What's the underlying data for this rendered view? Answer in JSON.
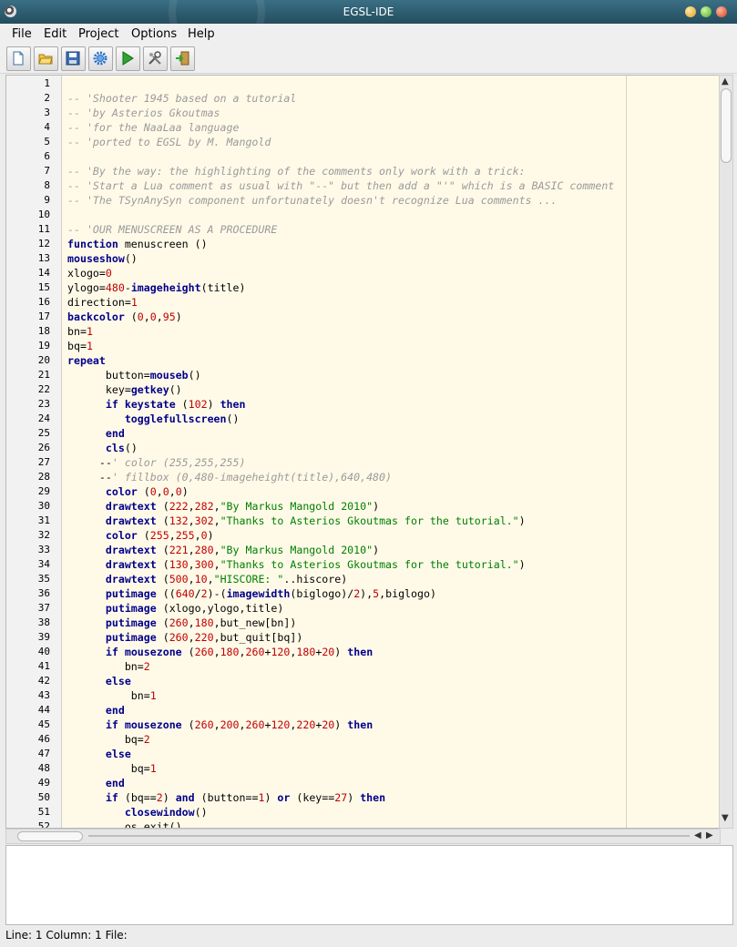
{
  "window": {
    "title": "EGSL-IDE"
  },
  "menu": [
    "File",
    "Edit",
    "Project",
    "Options",
    "Help"
  ],
  "toolbar": [
    {
      "name": "new-file-button",
      "icon": "new-document-icon"
    },
    {
      "name": "open-file-button",
      "icon": "open-folder-icon"
    },
    {
      "name": "save-file-button",
      "icon": "save-disk-icon"
    },
    {
      "name": "settings-button",
      "icon": "gear-icon"
    },
    {
      "name": "run-button",
      "icon": "play-icon"
    },
    {
      "name": "tools-button",
      "icon": "tools-icon"
    },
    {
      "name": "exit-button",
      "icon": "exit-door-icon"
    }
  ],
  "editor": {
    "line_numbers": [
      "1",
      "2",
      "3",
      "4",
      "5",
      "6",
      "7",
      "8",
      "9",
      "10",
      "11",
      "12",
      "13",
      "14",
      "15",
      "16",
      "17",
      "18",
      "19",
      "20",
      "21",
      "22",
      "23",
      "24",
      "25",
      "26",
      "27",
      "28",
      "29",
      "30",
      "31",
      "32",
      "33",
      "34",
      "35",
      "36",
      "37",
      "38",
      "39",
      "40",
      "41",
      "42",
      "43",
      "44",
      "45",
      "46",
      "47",
      "48",
      "49",
      "50",
      "51",
      "52"
    ],
    "lines": [
      [],
      [
        [
          "c",
          "-- 'Shooter 1945 based on a tutorial"
        ]
      ],
      [
        [
          "c",
          "-- 'by Asterios Gkoutmas"
        ]
      ],
      [
        [
          "c",
          "-- 'for the NaaLaa language"
        ]
      ],
      [
        [
          "c",
          "-- 'ported to EGSL by M. Mangold"
        ]
      ],
      [],
      [
        [
          "c",
          "-- 'By the way: the highlighting of the comments only work with a trick:"
        ]
      ],
      [
        [
          "c",
          "-- 'Start a Lua comment as usual with \"--\" but then add a \"'\" which is a BASIC comment"
        ]
      ],
      [
        [
          "c",
          "-- 'The TSynAnySyn component unfortunately doesn't recognize Lua comments ..."
        ]
      ],
      [],
      [
        [
          "c",
          "-- 'OUR MENUSCREEN AS A PROCEDURE"
        ]
      ],
      [
        [
          "k",
          "function"
        ],
        [
          "p",
          " menuscreen ()"
        ]
      ],
      [
        [
          "k",
          "mouseshow"
        ],
        [
          "p",
          "()"
        ]
      ],
      [
        [
          "p",
          "xlogo="
        ],
        [
          "n",
          "0"
        ]
      ],
      [
        [
          "p",
          "ylogo="
        ],
        [
          "n",
          "480"
        ],
        [
          "p",
          "-"
        ],
        [
          "k",
          "imageheight"
        ],
        [
          "p",
          "(title)"
        ]
      ],
      [
        [
          "p",
          "direction="
        ],
        [
          "n",
          "1"
        ]
      ],
      [
        [
          "k",
          "backcolor"
        ],
        [
          "p",
          " ("
        ],
        [
          "n",
          "0"
        ],
        [
          "p",
          ","
        ],
        [
          "n",
          "0"
        ],
        [
          "p",
          ","
        ],
        [
          "n",
          "95"
        ],
        [
          "p",
          ")"
        ]
      ],
      [
        [
          "p",
          "bn="
        ],
        [
          "n",
          "1"
        ]
      ],
      [
        [
          "p",
          "bq="
        ],
        [
          "n",
          "1"
        ]
      ],
      [
        [
          "k",
          "repeat"
        ]
      ],
      [
        [
          "p",
          "      button="
        ],
        [
          "k",
          "mouseb"
        ],
        [
          "p",
          "()"
        ]
      ],
      [
        [
          "p",
          "      key="
        ],
        [
          "k",
          "getkey"
        ],
        [
          "p",
          "()"
        ]
      ],
      [
        [
          "p",
          "      "
        ],
        [
          "k",
          "if"
        ],
        [
          "p",
          " "
        ],
        [
          "k",
          "keystate"
        ],
        [
          "p",
          " ("
        ],
        [
          "n",
          "102"
        ],
        [
          "p",
          ") "
        ],
        [
          "k",
          "then"
        ]
      ],
      [
        [
          "p",
          "         "
        ],
        [
          "k",
          "togglefullscreen"
        ],
        [
          "p",
          "()"
        ]
      ],
      [
        [
          "p",
          "      "
        ],
        [
          "k",
          "end"
        ]
      ],
      [
        [
          "p",
          "      "
        ],
        [
          "k",
          "cls"
        ],
        [
          "p",
          "()"
        ]
      ],
      [
        [
          "p",
          "     --"
        ],
        [
          "c",
          "' color (255,255,255)"
        ]
      ],
      [
        [
          "p",
          "     --"
        ],
        [
          "c",
          "' fillbox (0,480-imageheight(title),640,480)"
        ]
      ],
      [
        [
          "p",
          "      "
        ],
        [
          "k",
          "color"
        ],
        [
          "p",
          " ("
        ],
        [
          "n",
          "0"
        ],
        [
          "p",
          ","
        ],
        [
          "n",
          "0"
        ],
        [
          "p",
          ","
        ],
        [
          "n",
          "0"
        ],
        [
          "p",
          ")"
        ]
      ],
      [
        [
          "p",
          "      "
        ],
        [
          "k",
          "drawtext"
        ],
        [
          "p",
          " ("
        ],
        [
          "n",
          "222"
        ],
        [
          "p",
          ","
        ],
        [
          "n",
          "282"
        ],
        [
          "p",
          ","
        ],
        [
          "s",
          "\"By Markus Mangold 2010\""
        ],
        [
          "p",
          ")"
        ]
      ],
      [
        [
          "p",
          "      "
        ],
        [
          "k",
          "drawtext"
        ],
        [
          "p",
          " ("
        ],
        [
          "n",
          "132"
        ],
        [
          "p",
          ","
        ],
        [
          "n",
          "302"
        ],
        [
          "p",
          ","
        ],
        [
          "s",
          "\"Thanks to Asterios Gkoutmas for the tutorial.\""
        ],
        [
          "p",
          ")"
        ]
      ],
      [
        [
          "p",
          "      "
        ],
        [
          "k",
          "color"
        ],
        [
          "p",
          " ("
        ],
        [
          "n",
          "255"
        ],
        [
          "p",
          ","
        ],
        [
          "n",
          "255"
        ],
        [
          "p",
          ","
        ],
        [
          "n",
          "0"
        ],
        [
          "p",
          ")"
        ]
      ],
      [
        [
          "p",
          "      "
        ],
        [
          "k",
          "drawtext"
        ],
        [
          "p",
          " ("
        ],
        [
          "n",
          "221"
        ],
        [
          "p",
          ","
        ],
        [
          "n",
          "280"
        ],
        [
          "p",
          ","
        ],
        [
          "s",
          "\"By Markus Mangold 2010\""
        ],
        [
          "p",
          ")"
        ]
      ],
      [
        [
          "p",
          "      "
        ],
        [
          "k",
          "drawtext"
        ],
        [
          "p",
          " ("
        ],
        [
          "n",
          "130"
        ],
        [
          "p",
          ","
        ],
        [
          "n",
          "300"
        ],
        [
          "p",
          ","
        ],
        [
          "s",
          "\"Thanks to Asterios Gkoutmas for the tutorial.\""
        ],
        [
          "p",
          ")"
        ]
      ],
      [
        [
          "p",
          "      "
        ],
        [
          "k",
          "drawtext"
        ],
        [
          "p",
          " ("
        ],
        [
          "n",
          "500"
        ],
        [
          "p",
          ","
        ],
        [
          "n",
          "10"
        ],
        [
          "p",
          ","
        ],
        [
          "s",
          "\"HISCORE: \""
        ],
        [
          "p",
          "..hiscore)"
        ]
      ],
      [
        [
          "p",
          "      "
        ],
        [
          "k",
          "putimage"
        ],
        [
          "p",
          " (("
        ],
        [
          "n",
          "640"
        ],
        [
          "p",
          "/"
        ],
        [
          "n",
          "2"
        ],
        [
          "p",
          ")-("
        ],
        [
          "k",
          "imagewidth"
        ],
        [
          "p",
          "(biglogo)/"
        ],
        [
          "n",
          "2"
        ],
        [
          "p",
          "),"
        ],
        [
          "n",
          "5"
        ],
        [
          "p",
          ",biglogo)"
        ]
      ],
      [
        [
          "p",
          "      "
        ],
        [
          "k",
          "putimage"
        ],
        [
          "p",
          " (xlogo,ylogo,title)"
        ]
      ],
      [
        [
          "p",
          "      "
        ],
        [
          "k",
          "putimage"
        ],
        [
          "p",
          " ("
        ],
        [
          "n",
          "260"
        ],
        [
          "p",
          ","
        ],
        [
          "n",
          "180"
        ],
        [
          "p",
          ",but_new[bn])"
        ]
      ],
      [
        [
          "p",
          "      "
        ],
        [
          "k",
          "putimage"
        ],
        [
          "p",
          " ("
        ],
        [
          "n",
          "260"
        ],
        [
          "p",
          ","
        ],
        [
          "n",
          "220"
        ],
        [
          "p",
          ",but_quit[bq])"
        ]
      ],
      [
        [
          "p",
          "      "
        ],
        [
          "k",
          "if"
        ],
        [
          "p",
          " "
        ],
        [
          "k",
          "mousezone"
        ],
        [
          "p",
          " ("
        ],
        [
          "n",
          "260"
        ],
        [
          "p",
          ","
        ],
        [
          "n",
          "180"
        ],
        [
          "p",
          ","
        ],
        [
          "n",
          "260"
        ],
        [
          "p",
          "+"
        ],
        [
          "n",
          "120"
        ],
        [
          "p",
          ","
        ],
        [
          "n",
          "180"
        ],
        [
          "p",
          "+"
        ],
        [
          "n",
          "20"
        ],
        [
          "p",
          ") "
        ],
        [
          "k",
          "then"
        ]
      ],
      [
        [
          "p",
          "         bn="
        ],
        [
          "n",
          "2"
        ]
      ],
      [
        [
          "p",
          "      "
        ],
        [
          "k",
          "else"
        ]
      ],
      [
        [
          "p",
          "          bn="
        ],
        [
          "n",
          "1"
        ]
      ],
      [
        [
          "p",
          "      "
        ],
        [
          "k",
          "end"
        ]
      ],
      [
        [
          "p",
          "      "
        ],
        [
          "k",
          "if"
        ],
        [
          "p",
          " "
        ],
        [
          "k",
          "mousezone"
        ],
        [
          "p",
          " ("
        ],
        [
          "n",
          "260"
        ],
        [
          "p",
          ","
        ],
        [
          "n",
          "200"
        ],
        [
          "p",
          ","
        ],
        [
          "n",
          "260"
        ],
        [
          "p",
          "+"
        ],
        [
          "n",
          "120"
        ],
        [
          "p",
          ","
        ],
        [
          "n",
          "220"
        ],
        [
          "p",
          "+"
        ],
        [
          "n",
          "20"
        ],
        [
          "p",
          ") "
        ],
        [
          "k",
          "then"
        ]
      ],
      [
        [
          "p",
          "         bq="
        ],
        [
          "n",
          "2"
        ]
      ],
      [
        [
          "p",
          "      "
        ],
        [
          "k",
          "else"
        ]
      ],
      [
        [
          "p",
          "          bq="
        ],
        [
          "n",
          "1"
        ]
      ],
      [
        [
          "p",
          "      "
        ],
        [
          "k",
          "end"
        ]
      ],
      [
        [
          "p",
          "      "
        ],
        [
          "k",
          "if"
        ],
        [
          "p",
          " (bq=="
        ],
        [
          "n",
          "2"
        ],
        [
          "p",
          ") "
        ],
        [
          "k",
          "and"
        ],
        [
          "p",
          " (button=="
        ],
        [
          "n",
          "1"
        ],
        [
          "p",
          ") "
        ],
        [
          "k",
          "or"
        ],
        [
          "p",
          " (key=="
        ],
        [
          "n",
          "27"
        ],
        [
          "p",
          ") "
        ],
        [
          "k",
          "then"
        ]
      ],
      [
        [
          "p",
          "         "
        ],
        [
          "k",
          "closewindow"
        ],
        [
          "p",
          "()"
        ]
      ],
      [
        [
          "p",
          "         os.exit()"
        ]
      ]
    ]
  },
  "statusbar": {
    "text": "Line: 1 Column: 1 File:"
  }
}
